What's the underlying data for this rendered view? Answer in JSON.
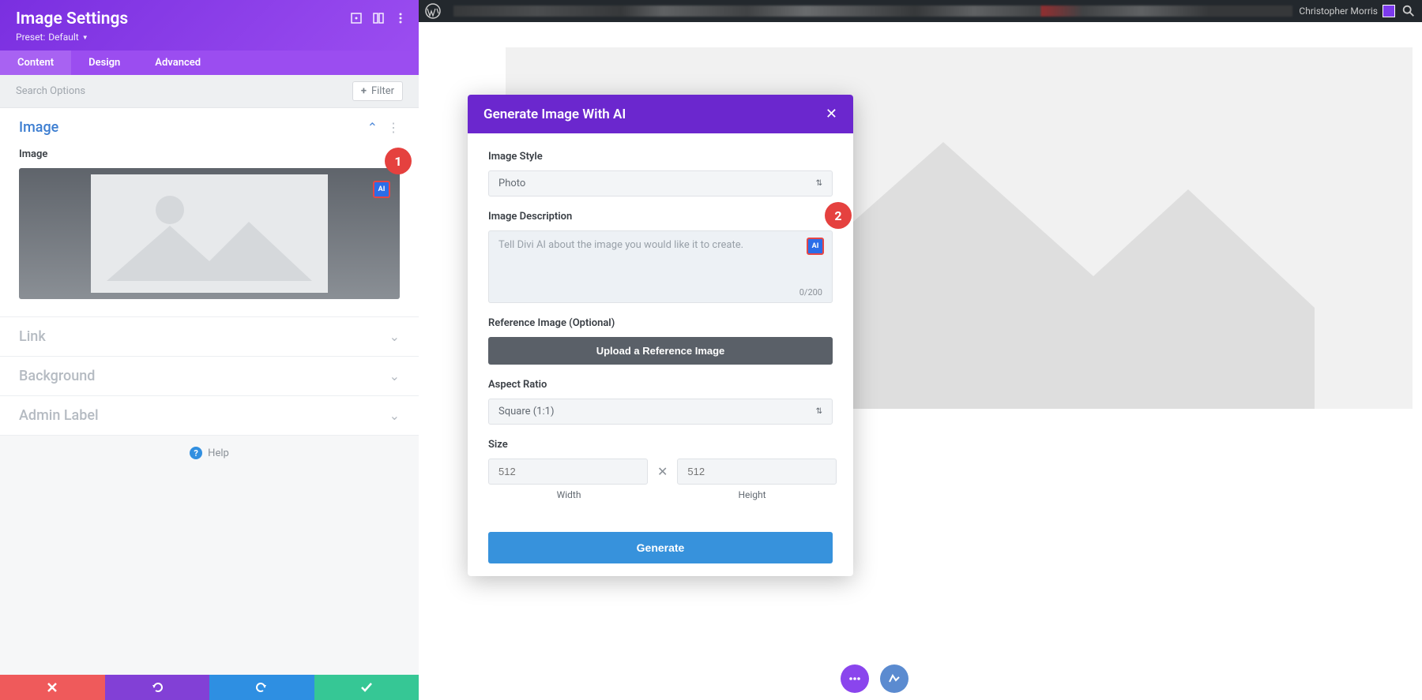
{
  "admin_bar": {
    "user": "Christopher Morris"
  },
  "panel": {
    "title": "Image Settings",
    "preset_label": "Preset:",
    "preset_value": "Default",
    "tabs": {
      "content": "Content",
      "design": "Design",
      "advanced": "Advanced"
    },
    "search_placeholder": "Search Options",
    "filter": "Filter",
    "sections": {
      "image": {
        "title": "Image",
        "field_label": "Image",
        "ai_badge": "AI"
      },
      "link": "Link",
      "background": "Background",
      "admin_label": "Admin Label"
    },
    "help": "Help"
  },
  "modal": {
    "title": "Generate Image With AI",
    "style_label": "Image Style",
    "style_value": "Photo",
    "desc_label": "Image Description",
    "desc_placeholder": "Tell Divi AI about the image you would like it to create.",
    "desc_counter": "0/200",
    "ref_label": "Reference Image (Optional)",
    "upload": "Upload a Reference Image",
    "ratio_label": "Aspect Ratio",
    "ratio_value": "Square (1:1)",
    "size_label": "Size",
    "width": "512",
    "height": "512",
    "width_label": "Width",
    "height_label": "Height",
    "generate": "Generate",
    "ai_badge": "AI"
  },
  "callouts": {
    "one": "1",
    "two": "2"
  }
}
